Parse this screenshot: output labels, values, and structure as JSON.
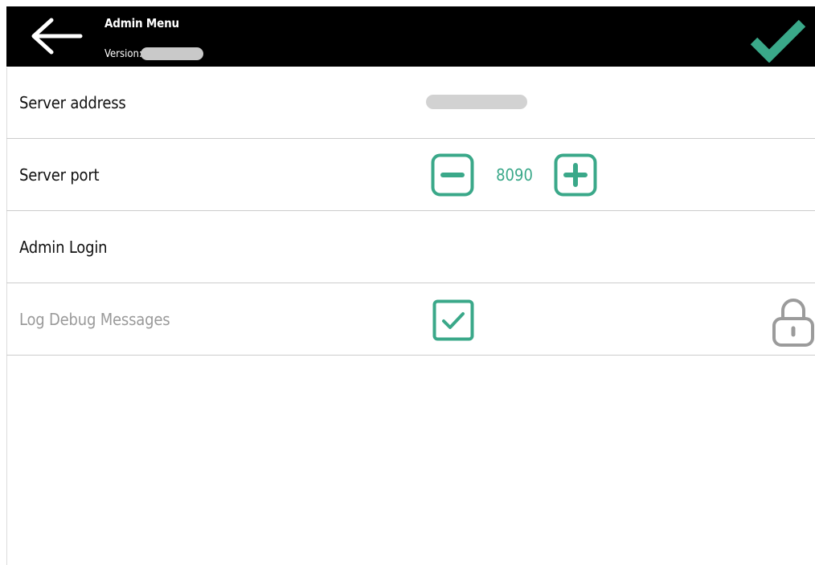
{
  "header": {
    "title": "Admin Menu",
    "version_label": "Version:",
    "back_icon": "arrow-left-icon",
    "confirm_icon": "checkmark-icon"
  },
  "rows": {
    "server_address": {
      "label": "Server address"
    },
    "server_port": {
      "label": "Server port",
      "value": "8090",
      "decrement_icon": "minus-box-icon",
      "increment_icon": "plus-box-icon"
    },
    "admin_login": {
      "label": "Admin Login"
    },
    "log_debug": {
      "label": "Log Debug Messages",
      "checked": true,
      "locked": true,
      "lock_icon": "padlock-icon"
    }
  },
  "colors": {
    "accent": "#3aa889",
    "header_bg": "#000000",
    "disabled_text": "#9a9a9a",
    "lock": "#9b9b9b"
  }
}
